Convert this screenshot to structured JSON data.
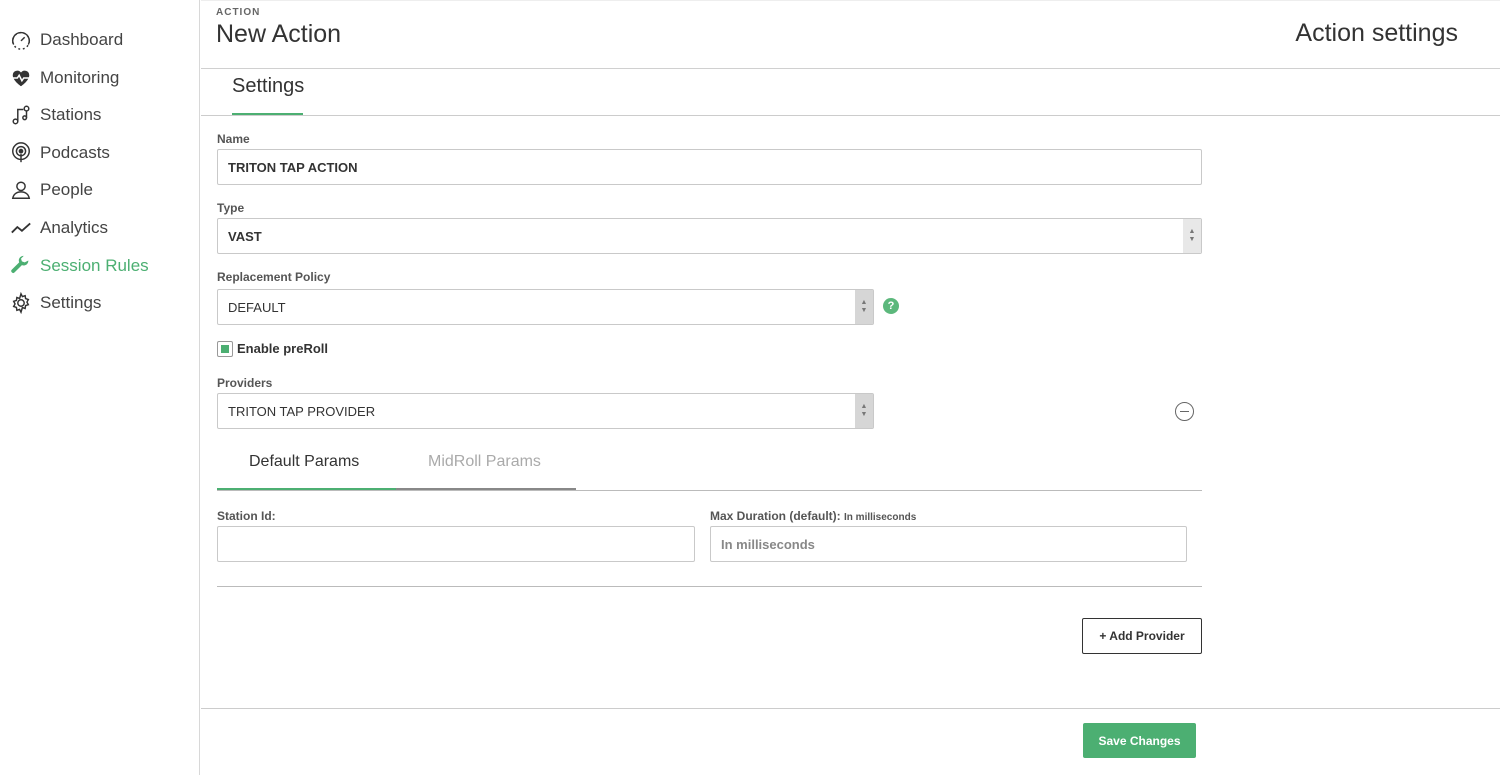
{
  "sidebar": {
    "items": [
      {
        "label": "Dashboard",
        "icon": "gauge-icon"
      },
      {
        "label": "Monitoring",
        "icon": "heartbeat-icon"
      },
      {
        "label": "Stations",
        "icon": "music-note-icon"
      },
      {
        "label": "Podcasts",
        "icon": "podcast-icon"
      },
      {
        "label": "People",
        "icon": "person-icon"
      },
      {
        "label": "Analytics",
        "icon": "line-chart-icon"
      },
      {
        "label": "Session Rules",
        "icon": "wrench-icon",
        "active": true
      },
      {
        "label": "Settings",
        "icon": "gear-icon"
      }
    ]
  },
  "header": {
    "overline": "ACTION",
    "title": "New Action",
    "right_title": "Action settings"
  },
  "tabs": {
    "settings": "Settings"
  },
  "form": {
    "name_label": "Name",
    "name_value": "TRITON TAP ACTION",
    "type_label": "Type",
    "type_value": "VAST",
    "replacement_label": "Replacement Policy",
    "replacement_value": "DEFAULT",
    "help": "?",
    "preroll_label": "Enable preRoll",
    "preroll_checked": true,
    "providers_label": "Providers",
    "providers_value": "TRITON TAP PROVIDER"
  },
  "params_tabs": {
    "default": "Default Params",
    "midroll": "MidRoll Params"
  },
  "params": {
    "station_id_label": "Station Id:",
    "station_id_value": "",
    "max_duration_label": "Max Duration (default):",
    "max_duration_hint": "In milliseconds",
    "max_duration_placeholder": "In milliseconds"
  },
  "buttons": {
    "add_provider": "+ Add Provider",
    "save_changes": "Save Changes"
  },
  "colors": {
    "accent": "#4caf72"
  }
}
